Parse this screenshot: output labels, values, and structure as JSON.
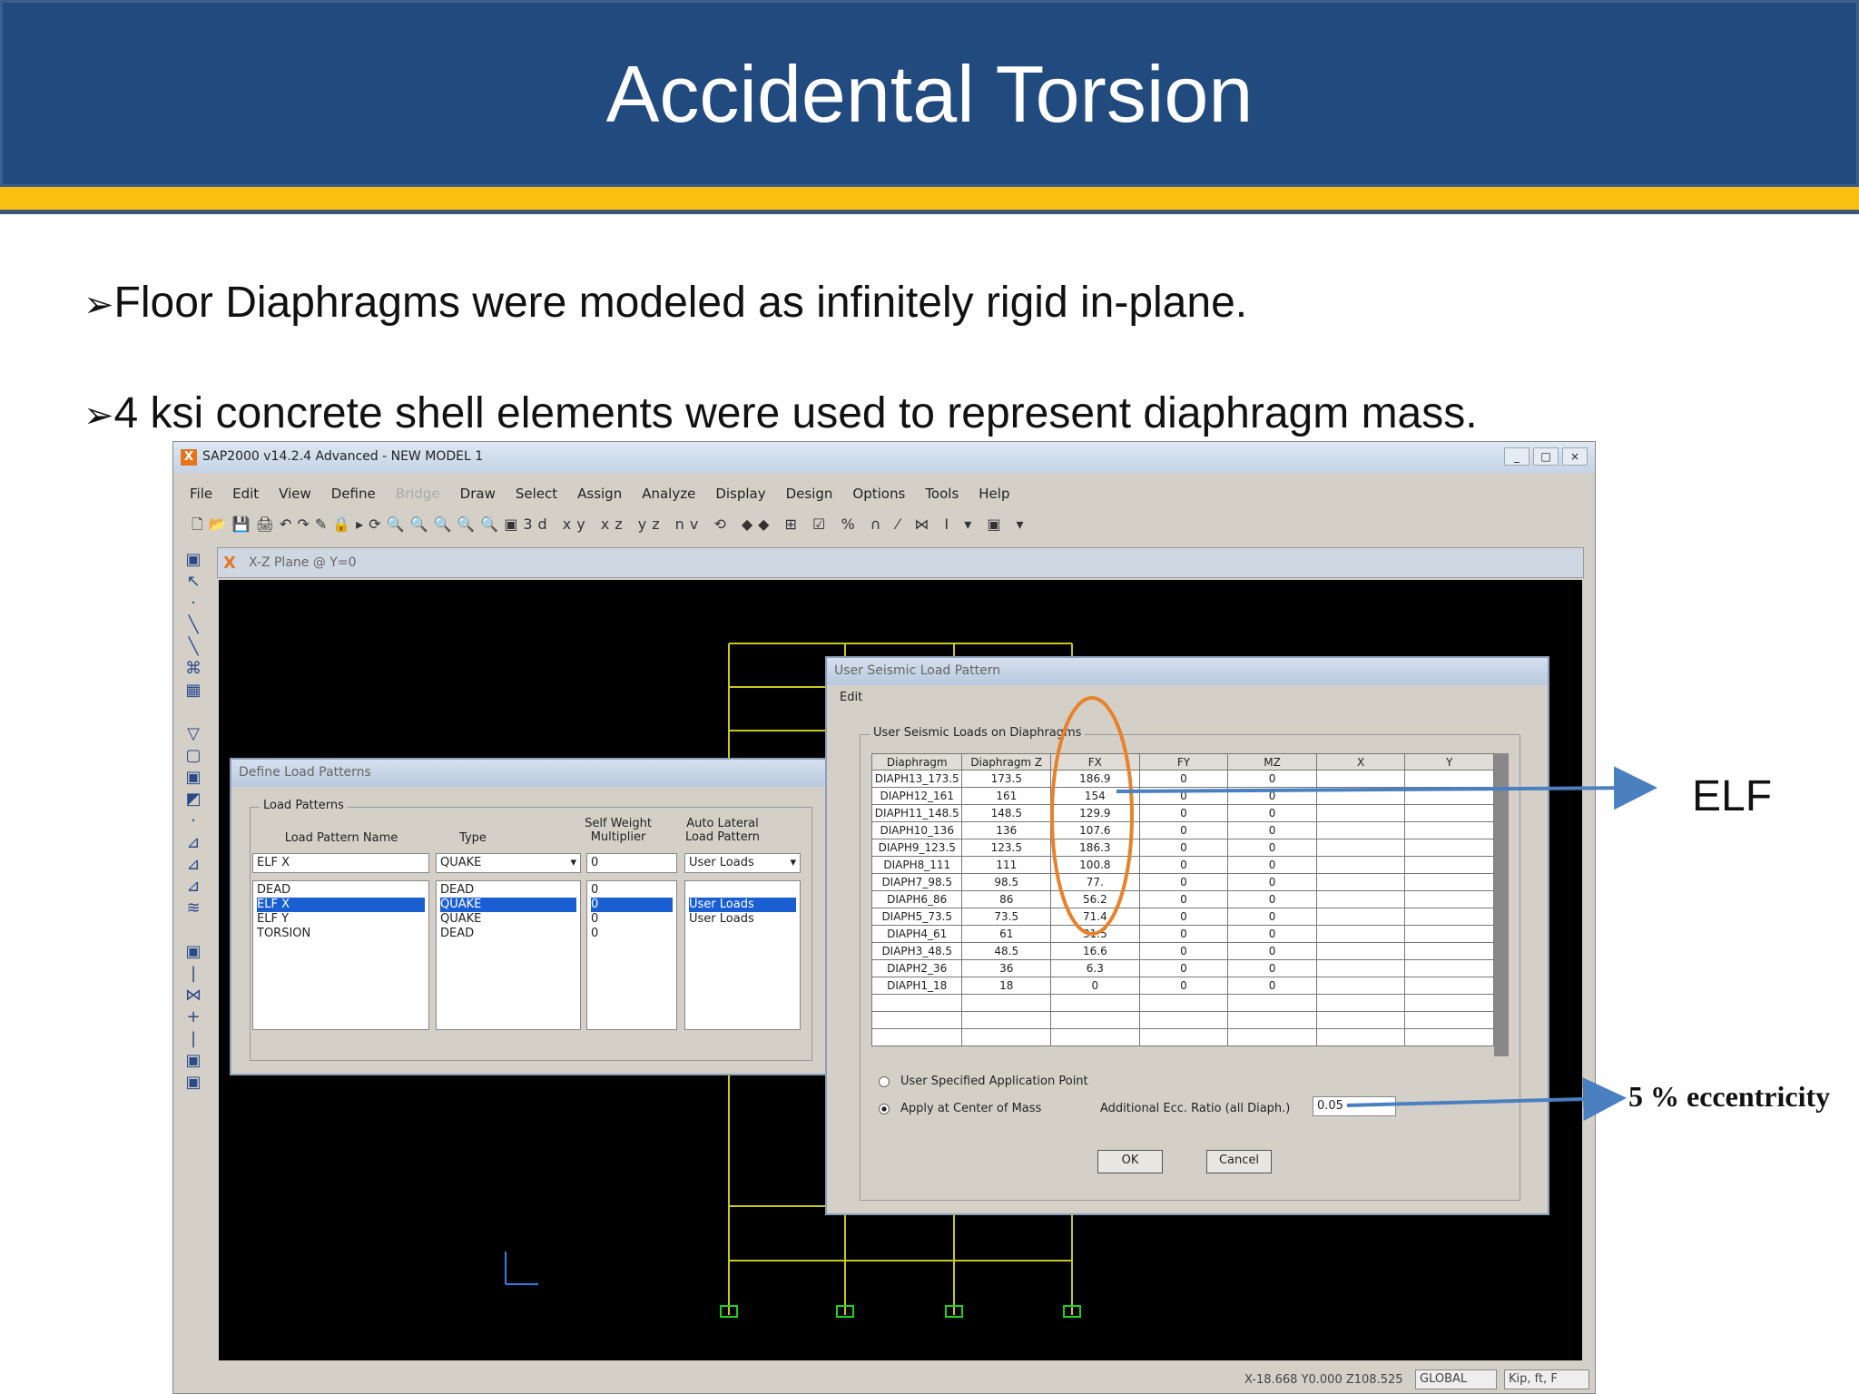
{
  "slide": {
    "title": "Accidental Torsion",
    "bullets": [
      "Floor Diaphragms were modeled as infinitely rigid in-plane.",
      "4 ksi concrete shell elements were used to represent diaphragm mass."
    ],
    "bullet_marker": "➢"
  },
  "app": {
    "title": "SAP2000 v14.2.4 Advanced  - NEW MODEL 1",
    "menus": [
      "File",
      "Edit",
      "View",
      "Define",
      "Bridge",
      "Draw",
      "Select",
      "Assign",
      "Analyze",
      "Display",
      "Design",
      "Options",
      "Tools",
      "Help"
    ],
    "view_title": "X-Z Plane @ Y=0",
    "status_coords": "X-18.668  Y0.000  Z108.525",
    "coord_system": "GLOBAL",
    "units": "Kip, ft, F"
  },
  "load_patterns": {
    "dialog_title": "Define Load Patterns",
    "group_label": "Load Patterns",
    "col_name": "Load Pattern Name",
    "col_type": "Type",
    "col_sw": "Self Weight Multiplier",
    "col_auto": "Auto Lateral Load Pattern",
    "input_name": "ELF X",
    "input_type": "QUAKE",
    "input_sw": "0",
    "input_auto": "User Loads",
    "names": [
      "DEAD",
      "ELF X",
      "ELF Y",
      "TORSION"
    ],
    "types": [
      "DEAD",
      "QUAKE",
      "QUAKE",
      "DEAD"
    ],
    "sw": [
      "0",
      "0",
      "0",
      "0"
    ],
    "auto": [
      "",
      "User Loads",
      "User Loads",
      ""
    ]
  },
  "seismic": {
    "dialog_title": "User Seismic Load Pattern",
    "menu": "Edit",
    "group_label": "User Seismic Loads on Diaphragms",
    "headers": [
      "Diaphragm",
      "Diaphragm Z",
      "FX",
      "FY",
      "MZ",
      "X",
      "Y"
    ],
    "rows": [
      [
        "DIAPH13_173.5",
        "173.5",
        "186.9",
        "0",
        "0",
        "",
        ""
      ],
      [
        "DIAPH12_161",
        "161",
        "154",
        "0",
        "0",
        "",
        ""
      ],
      [
        "DIAPH11_148.5",
        "148.5",
        "129.9",
        "0",
        "0",
        "",
        ""
      ],
      [
        "DIAPH10_136",
        "136",
        "107.6",
        "0",
        "0",
        "",
        ""
      ],
      [
        "DIAPH9_123.5",
        "123.5",
        "186.3",
        "0",
        "0",
        "",
        ""
      ],
      [
        "DIAPH8_111",
        "111",
        "100.8",
        "0",
        "0",
        "",
        ""
      ],
      [
        "DIAPH7_98.5",
        "98.5",
        "77.",
        "0",
        "0",
        "",
        ""
      ],
      [
        "DIAPH6_86",
        "86",
        "56.2",
        "0",
        "0",
        "",
        ""
      ],
      [
        "DIAPH5_73.5",
        "73.5",
        "71.4",
        "0",
        "0",
        "",
        ""
      ],
      [
        "DIAPH4_61",
        "61",
        "31.5",
        "0",
        "0",
        "",
        ""
      ],
      [
        "DIAPH3_48.5",
        "48.5",
        "16.6",
        "0",
        "0",
        "",
        ""
      ],
      [
        "DIAPH2_36",
        "36",
        "6.3",
        "0",
        "0",
        "",
        ""
      ],
      [
        "DIAPH1_18",
        "18",
        "0",
        "0",
        "0",
        "",
        ""
      ]
    ],
    "option_user_point": "User Specified Application Point",
    "option_center_mass": "Apply at Center of Mass",
    "ecc_label": "Additional Ecc. Ratio (all Diaph.)",
    "ecc_value": "0.05",
    "ok": "OK",
    "cancel": "Cancel"
  },
  "callouts": {
    "elf": "ELF",
    "ecc": "5 % eccentricity"
  },
  "colors": {
    "header_bg": "#214a7f",
    "gold_bar": "#f9c011",
    "frame_line": "#c8c81e",
    "highlight_oval": "#e8822a",
    "arrow": "#4a7fc0"
  }
}
